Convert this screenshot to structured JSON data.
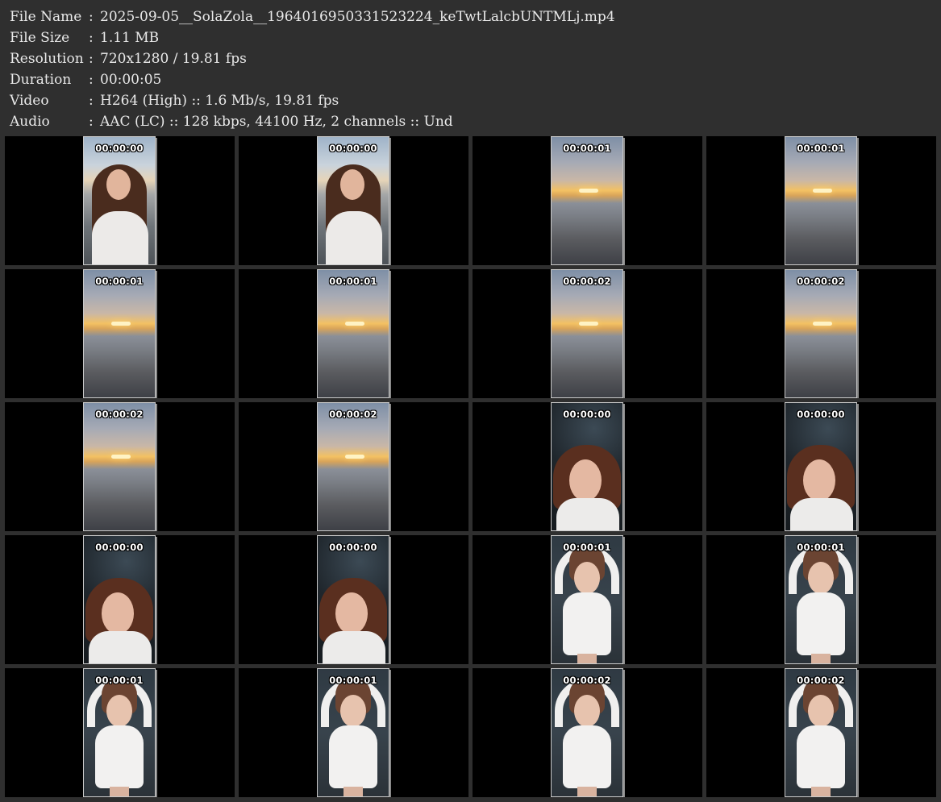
{
  "info": [
    {
      "label": "File Name",
      "value": "2025-09-05__SolaZola__1964016950331523224_keTwtLalcbUNTMLj.mp4"
    },
    {
      "label": "File Size",
      "value": "1.11 MB"
    },
    {
      "label": "Resolution",
      "value": "720x1280 / 19.81 fps"
    },
    {
      "label": "Duration",
      "value": "00:00:05"
    },
    {
      "label": "Video",
      "value": "H264 (High) :: 1.6 Mb/s, 19.81 fps"
    },
    {
      "label": "Audio",
      "value": "AAC (LC) :: 128 kbps, 44100 Hz, 2 channels :: Und"
    }
  ],
  "colon": ":",
  "thumbnails": [
    {
      "timestamp": "00:00:00",
      "scene": "portrait"
    },
    {
      "timestamp": "00:00:00",
      "scene": "portrait"
    },
    {
      "timestamp": "00:00:01",
      "scene": "sunset"
    },
    {
      "timestamp": "00:00:01",
      "scene": "sunset"
    },
    {
      "timestamp": "00:00:01",
      "scene": "sunset"
    },
    {
      "timestamp": "00:00:01",
      "scene": "sunset"
    },
    {
      "timestamp": "00:00:02",
      "scene": "sunset"
    },
    {
      "timestamp": "00:00:02",
      "scene": "sunset"
    },
    {
      "timestamp": "00:00:02",
      "scene": "sunset"
    },
    {
      "timestamp": "00:00:02",
      "scene": "sunset"
    },
    {
      "timestamp": "00:00:00",
      "scene": "down"
    },
    {
      "timestamp": "00:00:00",
      "scene": "down"
    },
    {
      "timestamp": "00:00:00",
      "scene": "down"
    },
    {
      "timestamp": "00:00:00",
      "scene": "down"
    },
    {
      "timestamp": "00:00:01",
      "scene": "overhead"
    },
    {
      "timestamp": "00:00:01",
      "scene": "overhead"
    },
    {
      "timestamp": "00:00:01",
      "scene": "overhead"
    },
    {
      "timestamp": "00:00:01",
      "scene": "overhead"
    },
    {
      "timestamp": "00:00:02",
      "scene": "overhead"
    },
    {
      "timestamp": "00:00:02",
      "scene": "overhead"
    }
  ]
}
